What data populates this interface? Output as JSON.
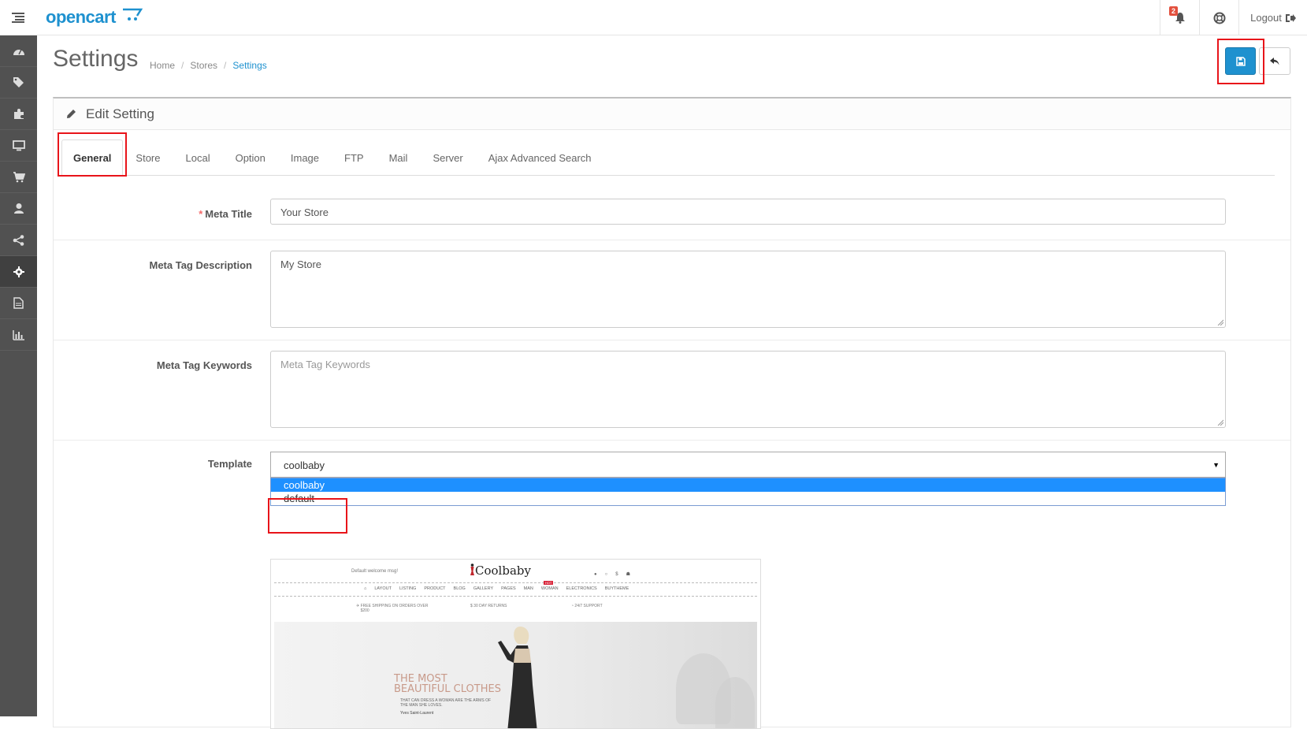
{
  "header": {
    "brand": "opencart",
    "notification_count": "2",
    "logout_label": "Logout"
  },
  "sidebar": {
    "items": [
      {
        "icon": "dashboard-icon"
      },
      {
        "icon": "tags-icon"
      },
      {
        "icon": "puzzle-icon"
      },
      {
        "icon": "monitor-icon"
      },
      {
        "icon": "cart-icon"
      },
      {
        "icon": "user-icon"
      },
      {
        "icon": "share-icon"
      },
      {
        "icon": "gear-icon",
        "active": true
      },
      {
        "icon": "report-icon"
      },
      {
        "icon": "bar-chart-icon"
      }
    ]
  },
  "page": {
    "title": "Settings",
    "breadcrumb": [
      "Home",
      "Stores",
      "Settings"
    ]
  },
  "panel": {
    "heading": "Edit Setting",
    "tabs": [
      "General",
      "Store",
      "Local",
      "Option",
      "Image",
      "FTP",
      "Mail",
      "Server",
      "Ajax Advanced Search"
    ],
    "active_tab": "General"
  },
  "form": {
    "meta_title_label": "Meta Title",
    "meta_title_value": "Your Store",
    "meta_description_label": "Meta Tag Description",
    "meta_description_value": "My Store",
    "meta_keywords_label": "Meta Tag Keywords",
    "meta_keywords_placeholder": "Meta Tag Keywords",
    "template_label": "Template",
    "template_value": "coolbaby",
    "template_options": [
      "coolbaby",
      "default"
    ]
  },
  "preview": {
    "welcome": "Default welcome msg!",
    "brand": "Coolbaby",
    "nav": [
      "LAYOUT",
      "LISTING",
      "PRODUCT",
      "BLOG",
      "GALLERY",
      "PAGES",
      "MAN",
      "WOMAN",
      "ELECTRONICS",
      "BUYTHEME"
    ],
    "hot_badge": "HOT",
    "features": [
      "FREE SHIPPING ON ORDERS OVER $200",
      "30 DAY RETURNS",
      "24/7 SUPPORT"
    ],
    "headline": "THE MOST BEAUTIFUL CLOTHES",
    "subline": "THAT CAN DRESS A WOMAN ARE THE ARMS OF THE MAN SHE LOVES.",
    "author": "Yves Saint-Laurent"
  }
}
